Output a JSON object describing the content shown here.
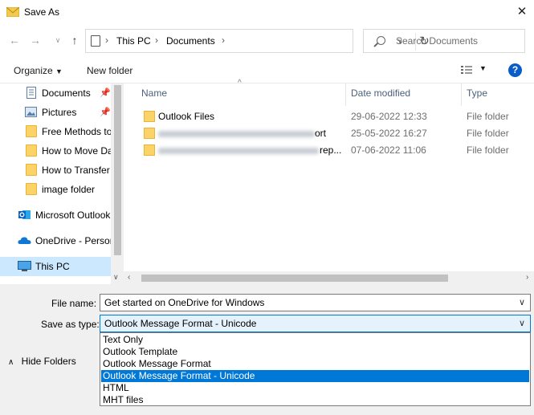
{
  "window": {
    "title": "Save As"
  },
  "navigation": {
    "breadcrumb": [
      "This PC",
      "Documents"
    ],
    "search_placeholder": "Search Documents"
  },
  "toolbar": {
    "organize": "Organize",
    "new_folder": "New folder"
  },
  "sidebar": {
    "items": [
      {
        "label": "Documents",
        "icon": "document-icon",
        "pinned": true
      },
      {
        "label": "Pictures",
        "icon": "picture-icon",
        "pinned": true
      },
      {
        "label": "Free Methods to",
        "icon": "folder-icon"
      },
      {
        "label": "How to Move Da",
        "icon": "folder-icon"
      },
      {
        "label": "How to Transfer",
        "icon": "folder-icon"
      },
      {
        "label": "image folder",
        "icon": "folder-icon"
      },
      {
        "label": "Microsoft Outlook",
        "icon": "outlook-icon"
      },
      {
        "label": "OneDrive - Persor",
        "icon": "onedrive-icon"
      },
      {
        "label": "This PC",
        "icon": "computer-icon",
        "selected": true
      }
    ]
  },
  "filelist": {
    "columns": [
      "Name",
      "Date modified",
      "Type"
    ],
    "rows": [
      {
        "name": "Outlook Files",
        "date": "29-06-2022 12:33",
        "type": "File folder"
      },
      {
        "name": "ort",
        "date": "25-05-2022 16:27",
        "type": "File folder"
      },
      {
        "name": "rep...",
        "date": "07-06-2022 11:06",
        "type": "File folder"
      }
    ]
  },
  "form": {
    "file_name_label": "File name:",
    "file_name_value": "Get started on OneDrive for Windows",
    "save_type_label": "Save as type:",
    "save_type_value": "Outlook Message Format - Unicode",
    "save_type_options": [
      "Text Only",
      "Outlook Template",
      "Outlook Message Format",
      "Outlook Message Format - Unicode",
      "HTML",
      "MHT files"
    ],
    "highlighted_index": 3
  },
  "footer": {
    "hide_folders": "Hide Folders"
  },
  "colors": {
    "accent": "#0078d7",
    "selected_nav": "#cce8ff",
    "help": "#0a5cc8"
  }
}
